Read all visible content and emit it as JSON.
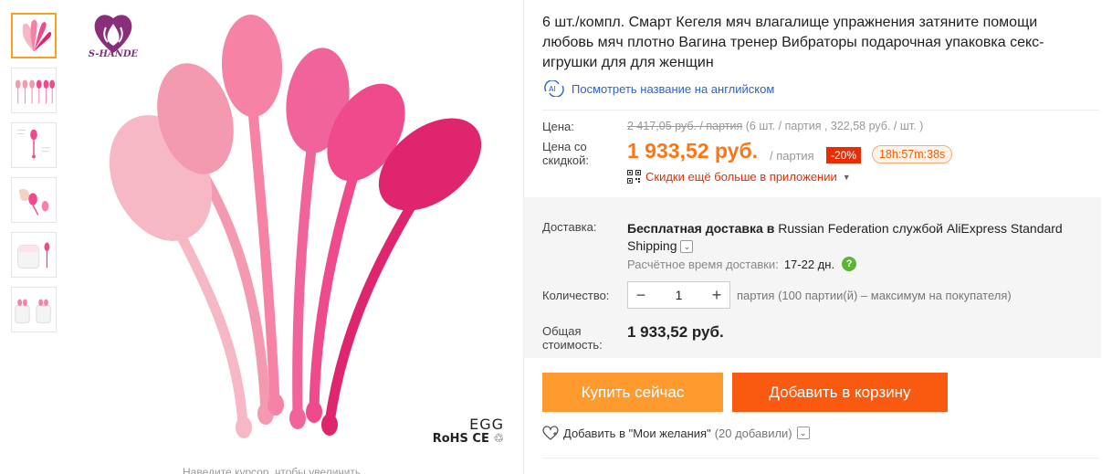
{
  "gallery": {
    "thumbnails": [
      "thumb-1",
      "thumb-2",
      "thumb-3",
      "thumb-4",
      "thumb-5",
      "thumb-6"
    ],
    "selected_index": 0,
    "brand_name": "S-HANDE",
    "product_marking": "EGG",
    "certifications": "RoHS CE ♲",
    "zoom_hint": "Наведите курсор, чтобы увеличить",
    "colors": [
      "#f5b8c4",
      "#f49ab0",
      "#f683a6",
      "#f1649b",
      "#ee4a8c",
      "#e43180",
      "#e0256f"
    ]
  },
  "product": {
    "title": "6 шт./компл. Смарт Кегеля мяч влагалище упражнения затяните помощи любовь мяч плотно Вагина тренер Вибраторы подарочная упаковка секс-игрушки для для женщин",
    "translate_link": "Посмотреть название на английском"
  },
  "pricing": {
    "price_label": "Цена:",
    "old_price": "2 417,05 руб. / партия",
    "old_price_note": "(6 шт. / партия , 322,58 руб. / шт. )",
    "discount_label": "Цена со скидкой:",
    "new_price": "1 933,52 руб.",
    "per_lot": "/ партия",
    "discount_badge": "-20%",
    "timer": "18h:57m:38s",
    "app_promo": "Скидки ещё больше в приложении",
    "accent": "#ff7415",
    "badge_color": "#e62e04"
  },
  "shipping": {
    "label": "Доставка:",
    "free_text": "Бесплатная доставка в",
    "region_text": "Russian Federation службой",
    "carrier": "AliExpress Standard Shipping",
    "eta_label": "Расчётное время доставки:",
    "eta_value": "17-22 дн."
  },
  "quantity": {
    "label": "Количество:",
    "value": "1",
    "note": "партия (100 партии(й) – максимум на покупателя)"
  },
  "total": {
    "label": "Общая стоимость:",
    "value": "1 933,52 руб."
  },
  "actions": {
    "buy_now": "Купить сейчас",
    "add_to_cart": "Добавить в корзину",
    "wishlist": "Добавить в \"Мои желания\"",
    "wishlist_count": "(20 добавили)",
    "buy_color": "#ff9a2e",
    "cart_color": "#fa5a10"
  }
}
